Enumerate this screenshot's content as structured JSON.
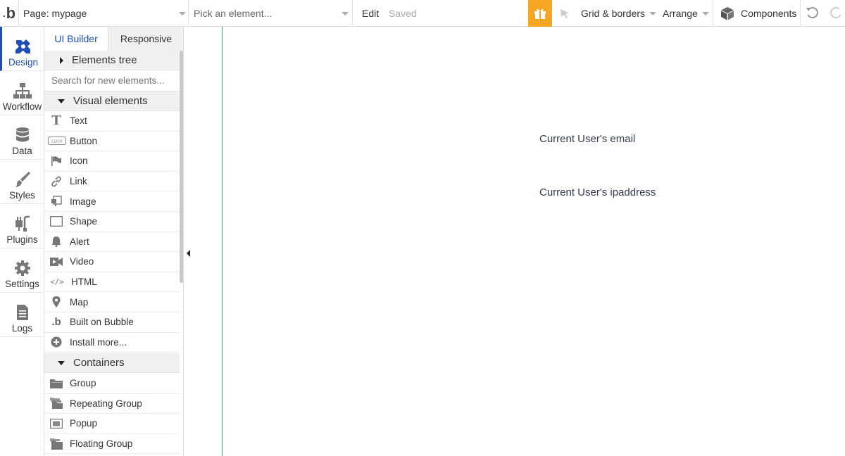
{
  "topbar": {
    "logo": "b",
    "page_label": "Page: mypage",
    "element_picker_placeholder": "Pick an element...",
    "edit_label": "Edit",
    "saved_label": "Saved",
    "grid_label": "Grid & borders",
    "arrange_label": "Arrange",
    "components_label": "Components",
    "accent_color": "#f5a623"
  },
  "leftnav": {
    "items": [
      {
        "label": "Design",
        "icon": "design-icon",
        "active": true
      },
      {
        "label": "Workflow",
        "icon": "workflow-icon"
      },
      {
        "label": "Data",
        "icon": "database-icon"
      },
      {
        "label": "Styles",
        "icon": "brush-icon"
      },
      {
        "label": "Plugins",
        "icon": "plug-icon"
      },
      {
        "label": "Settings",
        "icon": "gear-icon"
      },
      {
        "label": "Logs",
        "icon": "document-icon"
      }
    ],
    "active_color": "#1f4eb4"
  },
  "panel": {
    "tabs": [
      {
        "label": "UI Builder"
      },
      {
        "label": "Responsive"
      }
    ],
    "elements_tree_label": "Elements tree",
    "search_placeholder": "Search for new elements...",
    "visual_elements_label": "Visual elements",
    "visual_elements": [
      {
        "label": "Text",
        "icon": "text-icon"
      },
      {
        "label": "Button",
        "icon": "button-icon"
      },
      {
        "label": "Icon",
        "icon": "flag-icon"
      },
      {
        "label": "Link",
        "icon": "link-icon"
      },
      {
        "label": "Image",
        "icon": "image-icon"
      },
      {
        "label": "Shape",
        "icon": "square-icon"
      },
      {
        "label": "Alert",
        "icon": "bell-icon"
      },
      {
        "label": "Video",
        "icon": "video-icon"
      },
      {
        "label": "HTML",
        "icon": "code-icon"
      },
      {
        "label": "Map",
        "icon": "map-pin-icon"
      },
      {
        "label": "Built on Bubble",
        "icon": "bubble-logo-icon"
      },
      {
        "label": "Install more...",
        "icon": "plus-circle-icon"
      }
    ],
    "containers_label": "Containers",
    "containers": [
      {
        "label": "Group",
        "icon": "folder-icon"
      },
      {
        "label": "Repeating Group",
        "icon": "stacked-folder-icon"
      },
      {
        "label": "Popup",
        "icon": "popup-icon"
      },
      {
        "label": "Floating Group",
        "icon": "floating-folder-icon"
      }
    ]
  },
  "canvas": {
    "texts": [
      "Current User's email",
      "Current User's ipaddress"
    ]
  }
}
